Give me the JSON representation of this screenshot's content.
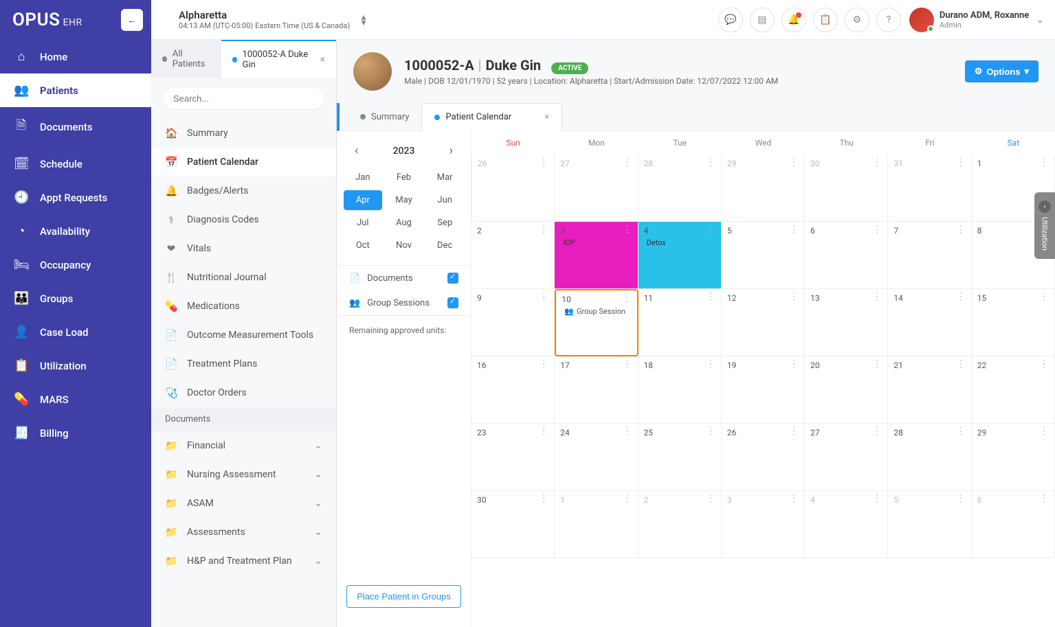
{
  "brand": {
    "name": "OPUS",
    "suffix": "EHR"
  },
  "location": {
    "name": "Alpharetta",
    "tz": "04:13 AM (UTC-05:00) Eastern Time (US & Canada)"
  },
  "user": {
    "name": "Durano ADM, Roxanne",
    "role": "Admin"
  },
  "sidebar": {
    "items": [
      {
        "label": "Home",
        "icon": "⌂"
      },
      {
        "label": "Patients",
        "icon": "👥",
        "active": true
      },
      {
        "label": "Documents",
        "icon": "🗎"
      },
      {
        "label": "Schedule",
        "icon": "🗓"
      },
      {
        "label": "Appt Requests",
        "icon": "🕘"
      },
      {
        "label": "Availability",
        "icon": "◔"
      },
      {
        "label": "Occupancy",
        "icon": "🛏"
      },
      {
        "label": "Groups",
        "icon": "👪"
      },
      {
        "label": "Case Load",
        "icon": "👤"
      },
      {
        "label": "Utilization",
        "icon": "📋"
      },
      {
        "label": "MARS",
        "icon": "💊"
      },
      {
        "label": "Billing",
        "icon": "🧾"
      }
    ]
  },
  "patientTabs": {
    "all": "All Patients",
    "current": "1000052-A Duke Gin"
  },
  "search": {
    "placeholder": "Search..."
  },
  "psb": {
    "items": [
      {
        "label": "Summary",
        "icon": "🏠"
      },
      {
        "label": "Patient Calendar",
        "icon": "📅",
        "active": true
      },
      {
        "label": "Badges/Alerts",
        "icon": "🔔"
      },
      {
        "label": "Diagnosis Codes",
        "icon": "⚕"
      },
      {
        "label": "Vitals",
        "icon": "❤"
      },
      {
        "label": "Nutritional Journal",
        "icon": "🍴"
      },
      {
        "label": "Medications",
        "icon": "💊"
      },
      {
        "label": "Outcome Measurement Tools",
        "icon": "📄"
      },
      {
        "label": "Treatment Plans",
        "icon": "📄"
      },
      {
        "label": "Doctor Orders",
        "icon": "🩺"
      }
    ],
    "docsHeader": "Documents",
    "docItems": [
      {
        "label": "Financial",
        "icon": "📁"
      },
      {
        "label": "Nursing Assessment",
        "icon": "📁"
      },
      {
        "label": "ASAM",
        "icon": "📁"
      },
      {
        "label": "Assessments",
        "icon": "📁"
      },
      {
        "label": "H&P and Treatment Plan",
        "icon": "📁"
      }
    ]
  },
  "patient": {
    "id": "1000052-A",
    "name": "Duke Gin",
    "status": "ACTIVE",
    "meta": "Male  |  DOB 12/01/1970  |  52 years  |  Location: Alpharetta  |  Start/Admission Date: 12/07/2022 12:00 AM",
    "optionsLabel": "Options"
  },
  "innerTabs": {
    "summary": "Summary",
    "calendar": "Patient Calendar"
  },
  "calSide": {
    "year": "2023",
    "months": [
      "Jan",
      "Feb",
      "Mar",
      "Apr",
      "May",
      "Jun",
      "Jul",
      "Aug",
      "Sep",
      "Oct",
      "Nov",
      "Dec"
    ],
    "activeMonth": "Apr",
    "filterDocs": "Documents",
    "filterGroups": "Group Sessions",
    "remaining": "Remaining approved units:",
    "placeBtn": "Place Patient in Groups"
  },
  "dayNames": [
    "Sun",
    "Mon",
    "Tue",
    "Wed",
    "Thu",
    "Fri",
    "Sat"
  ],
  "events": {
    "iop": "IOP",
    "detox": "Detox",
    "group": "Group Session"
  },
  "utilTab": "Utilization"
}
